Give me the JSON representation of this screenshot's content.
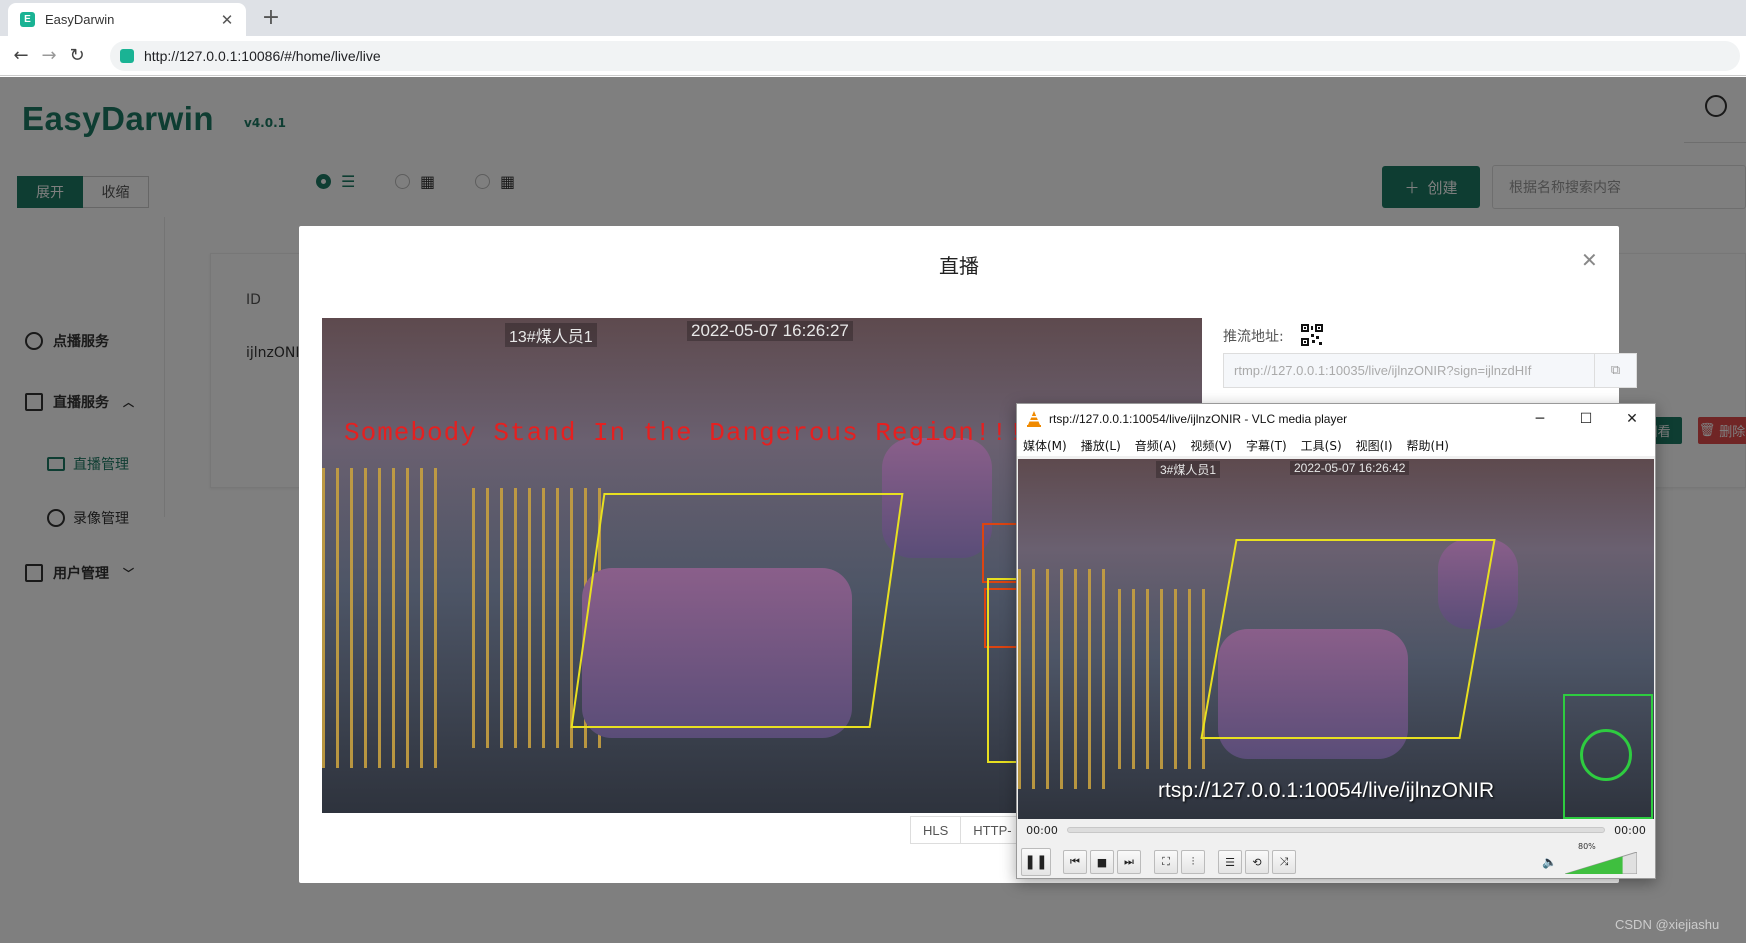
{
  "browser": {
    "tab_title": "EasyDarwin",
    "url": "http://127.0.0.1:10086/#/home/live/live"
  },
  "app": {
    "logo": "EasyDarwin",
    "version": "v4.0.1",
    "expand_label": "展开",
    "collapse_label": "收缩",
    "create_label": "创建",
    "search_placeholder": "根据名称搜索内容",
    "sidebar": {
      "vod": "点播服务",
      "live": "直播服务",
      "live_manage": "直播管理",
      "record_manage": "录像管理",
      "user_manage": "用户管理"
    },
    "table": {
      "col_id": "ID",
      "row_id": "ijlnzONI",
      "playback_label": "回看",
      "delete_label": "删除"
    }
  },
  "modal": {
    "title": "直播",
    "stream_label": "推流地址:",
    "stream_url": "rtmp://127.0.0.1:10035/live/ijlnzONIR?sign=ijlnzdHIf",
    "protocols": [
      "HLS",
      "HTTP-"
    ],
    "video": {
      "osd_name": "13#煤人员1",
      "osd_time": "2022-05-07 16:26:27",
      "warning": "Somebody Stand In the Dangerous Region!!!"
    }
  },
  "vlc": {
    "title": "rtsp://127.0.0.1:10054/live/ijlnzONIR - VLC media player",
    "menus": [
      "媒体(M)",
      "播放(L)",
      "音频(A)",
      "视频(V)",
      "字幕(T)",
      "工具(S)",
      "视图(I)",
      "帮助(H)"
    ],
    "osd_name": "3#煤人员1",
    "osd_time": "2022-05-07 16:26:42",
    "osd_url": "rtsp://127.0.0.1:10054/live/ijlnzONIR",
    "time_elapsed": "00:00",
    "time_total": "00:00",
    "volume_pct": "80%",
    "volume": 0.8
  },
  "watermark": "CSDN @xiejiashu",
  "colors": {
    "brand": "#1d7a64",
    "danger": "#e04b4b",
    "warning_text": "#e52020",
    "roi_yellow": "#e8e020"
  }
}
